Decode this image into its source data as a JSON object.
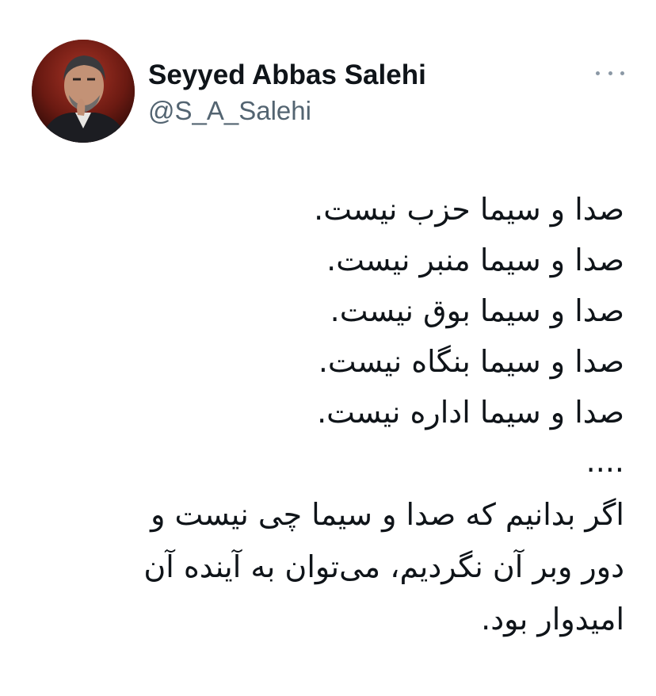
{
  "author": {
    "display_name": "Seyyed Abbas Salehi",
    "handle": "@S_A_Salehi",
    "avatar_icon": "profile-photo"
  },
  "actions": {
    "more_icon": "more-horizontal-icon"
  },
  "tweet": {
    "lines": [
      "صدا و سیما حزب نیست.",
      "صدا و سیما منبر نیست.",
      "صدا و سیما بوق نیست.",
      "صدا و سیما بنگاه نیست.",
      "صدا و سیما اداره نیست."
    ],
    "ellipsis": "....",
    "closing": [
      "اگر بدانیم که صدا و سیما چی نیست و",
      "دور وبر آن نگردیم، می‌توان به آینده آن",
      "امیدوار بود."
    ]
  },
  "colors": {
    "text": "#0f1419",
    "secondary": "#536471",
    "background": "#ffffff"
  }
}
